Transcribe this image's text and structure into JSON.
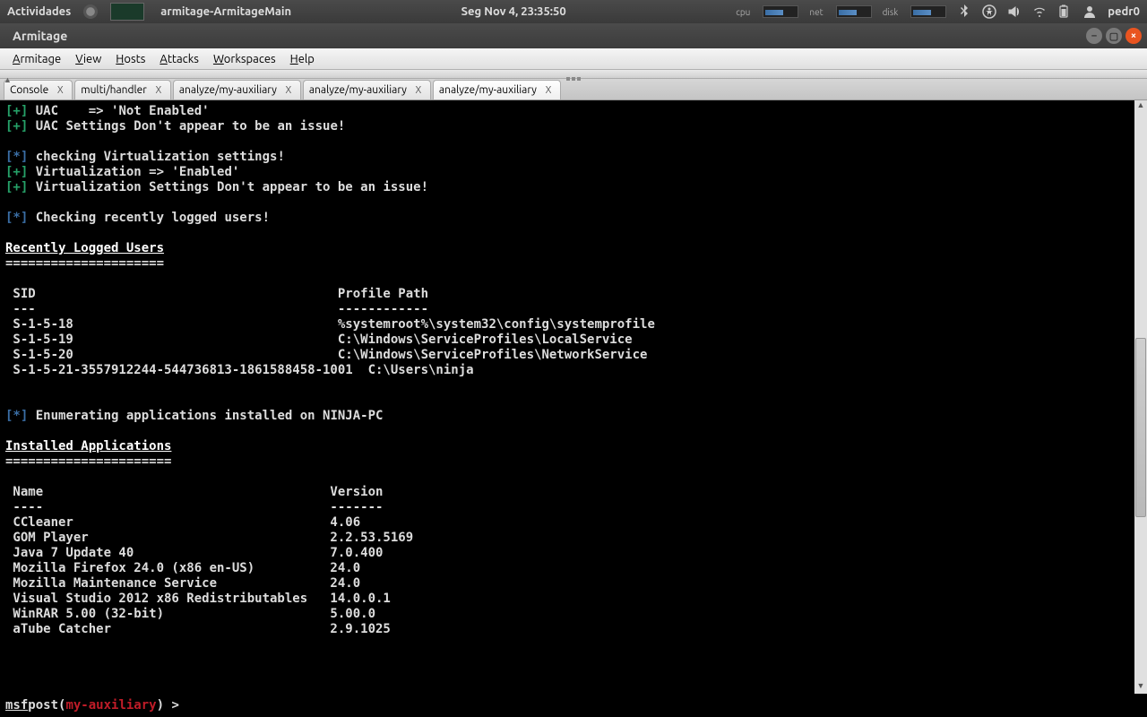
{
  "panel": {
    "activities": "Actividades",
    "task": "armitage-ArmitageMain",
    "clock": "Seg Nov  4, 23:35:50",
    "cpu": "cpu",
    "net": "net",
    "disk": "disk",
    "user": "pedr0"
  },
  "window": {
    "title": "Armitage"
  },
  "menu": {
    "items": [
      "Armitage",
      "View",
      "Hosts",
      "Attacks",
      "Workspaces",
      "Help"
    ]
  },
  "tabs": [
    {
      "label": "Console",
      "active": false
    },
    {
      "label": "multi/handler",
      "active": false
    },
    {
      "label": "analyze/my-auxiliary",
      "active": false
    },
    {
      "label": "analyze/my-auxiliary",
      "active": false
    },
    {
      "label": "analyze/my-auxiliary",
      "active": true
    }
  ],
  "console": {
    "lines": [
      {
        "pre": "[+]",
        "cls": "plus",
        "txt": " UAC    => 'Not Enabled'"
      },
      {
        "pre": "[+]",
        "cls": "plus",
        "txt": " UAC Settings Don't appear to be an issue!"
      },
      {
        "pre": "",
        "cls": "reg",
        "txt": ""
      },
      {
        "pre": "[*]",
        "cls": "star",
        "txt": " checking Virtualization settings!"
      },
      {
        "pre": "[+]",
        "cls": "plus",
        "txt": " Virtualization => 'Enabled'"
      },
      {
        "pre": "[+]",
        "cls": "plus",
        "txt": " Virtualization Settings Don't appear to be an issue!"
      },
      {
        "pre": "",
        "cls": "reg",
        "txt": ""
      },
      {
        "pre": "[*]",
        "cls": "star",
        "txt": " Checking recently logged users!"
      },
      {
        "pre": "",
        "cls": "reg",
        "txt": ""
      },
      {
        "pre": "",
        "cls": "hdr",
        "txt": "Recently Logged Users"
      },
      {
        "pre": "",
        "cls": "reg",
        "txt": "====================="
      },
      {
        "pre": "",
        "cls": "reg",
        "txt": ""
      },
      {
        "pre": "",
        "cls": "reg",
        "txt": " SID                                        Profile Path"
      },
      {
        "pre": "",
        "cls": "reg",
        "txt": " ---                                        ------------"
      },
      {
        "pre": "",
        "cls": "reg",
        "txt": " S-1-5-18                                   %systemroot%\\system32\\config\\systemprofile"
      },
      {
        "pre": "",
        "cls": "reg",
        "txt": " S-1-5-19                                   C:\\Windows\\ServiceProfiles\\LocalService"
      },
      {
        "pre": "",
        "cls": "reg",
        "txt": " S-1-5-20                                   C:\\Windows\\ServiceProfiles\\NetworkService"
      },
      {
        "pre": "",
        "cls": "reg",
        "txt": " S-1-5-21-3557912244-544736813-1861588458-1001  C:\\Users\\ninja"
      },
      {
        "pre": "",
        "cls": "reg",
        "txt": ""
      },
      {
        "pre": "",
        "cls": "reg",
        "txt": ""
      },
      {
        "pre": "[*]",
        "cls": "star",
        "txt": " Enumerating applications installed on NINJA-PC"
      },
      {
        "pre": "",
        "cls": "reg",
        "txt": ""
      },
      {
        "pre": "",
        "cls": "hdr",
        "txt": "Installed Applications"
      },
      {
        "pre": "",
        "cls": "reg",
        "txt": "======================"
      },
      {
        "pre": "",
        "cls": "reg",
        "txt": ""
      },
      {
        "pre": "",
        "cls": "reg",
        "txt": " Name                                      Version"
      },
      {
        "pre": "",
        "cls": "reg",
        "txt": " ----                                      -------"
      },
      {
        "pre": "",
        "cls": "reg",
        "txt": " CCleaner                                  4.06"
      },
      {
        "pre": "",
        "cls": "reg",
        "txt": " GOM Player                                2.2.53.5169"
      },
      {
        "pre": "",
        "cls": "reg",
        "txt": " Java 7 Update 40                          7.0.400"
      },
      {
        "pre": "",
        "cls": "reg",
        "txt": " Mozilla Firefox 24.0 (x86 en-US)          24.0"
      },
      {
        "pre": "",
        "cls": "reg",
        "txt": " Mozilla Maintenance Service               24.0"
      },
      {
        "pre": "",
        "cls": "reg",
        "txt": " Visual Studio 2012 x86 Redistributables   14.0.0.1"
      },
      {
        "pre": "",
        "cls": "reg",
        "txt": " WinRAR 5.00 (32-bit)                      5.00.0"
      },
      {
        "pre": "",
        "cls": "reg",
        "txt": " aTube Catcher                             2.9.1025"
      }
    ]
  },
  "prompt": {
    "msf": "msf",
    "post": "  post(",
    "ctx": "my-auxiliary",
    "tail": ") > "
  },
  "recently_logged_users": [
    {
      "sid": "S-1-5-18",
      "path": "%systemroot%\\system32\\config\\systemprofile"
    },
    {
      "sid": "S-1-5-19",
      "path": "C:\\Windows\\ServiceProfiles\\LocalService"
    },
    {
      "sid": "S-1-5-20",
      "path": "C:\\Windows\\ServiceProfiles\\NetworkService"
    },
    {
      "sid": "S-1-5-21-3557912244-544736813-1861588458-1001",
      "path": "C:\\Users\\ninja"
    }
  ],
  "installed_applications": [
    {
      "name": "CCleaner",
      "version": "4.06"
    },
    {
      "name": "GOM Player",
      "version": "2.2.53.5169"
    },
    {
      "name": "Java 7 Update 40",
      "version": "7.0.400"
    },
    {
      "name": "Mozilla Firefox 24.0 (x86 en-US)",
      "version": "24.0"
    },
    {
      "name": "Mozilla Maintenance Service",
      "version": "24.0"
    },
    {
      "name": "Visual Studio 2012 x86 Redistributables",
      "version": "14.0.0.1"
    },
    {
      "name": "WinRAR 5.00 (32-bit)",
      "version": "5.00.0"
    },
    {
      "name": "aTube Catcher",
      "version": "2.9.1025"
    }
  ]
}
